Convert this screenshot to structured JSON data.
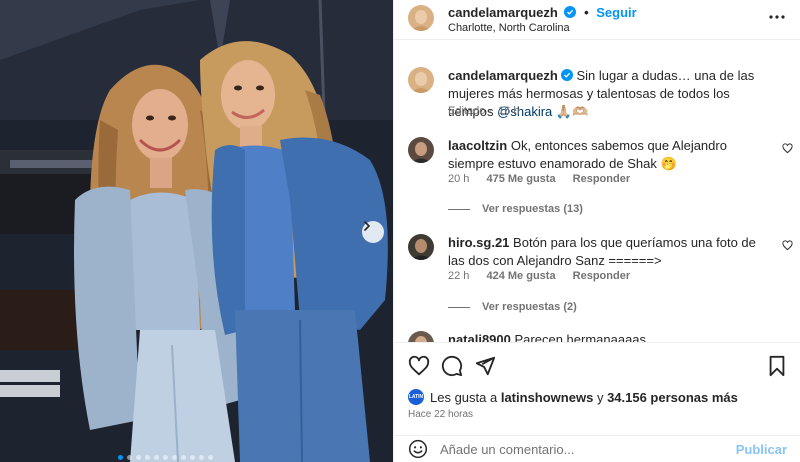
{
  "post": {
    "username": "candelamarquezh",
    "follow_label": "Seguir",
    "separator": "•",
    "location": "Charlotte, North Carolina",
    "caption": {
      "username": "candelamarquezh",
      "text": "Sin lugar a dudas… una de las mujeres más hermosas y talentosas de todos los tiempos",
      "mention": "@shakira",
      "emoji": "🙏🏼🫶🏼",
      "edited": "Editado",
      "time": "16 h"
    },
    "comments": [
      {
        "username": "laacoltzin",
        "text": "Ok, entonces sabemos que Alejandro siempre estuvo enamorado de Shak 🤭",
        "time": "20 h",
        "likes": "475 Me gusta",
        "reply_label": "Responder",
        "view_replies": "Ver respuestas (13)"
      },
      {
        "username": "hiro.sg.21",
        "text": "Botón para los que queríamos una foto de las dos con Alejandro Sanz ======>",
        "time": "22 h",
        "likes": "424 Me gusta",
        "reply_label": "Responder",
        "view_replies": "Ver respuestas (2)"
      },
      {
        "username": "natali8900",
        "text": "Parecen hermanaaaas"
      }
    ],
    "likes_summary": {
      "avatar_text": "LATIN",
      "prefix": "Les gusta a",
      "user": "latinshownews",
      "connector": "y",
      "count": "34.156 personas más"
    },
    "time_ago": "Hace 22 horas",
    "comment_placeholder": "Añade un comentario...",
    "post_label": "Publicar",
    "carousel_dots": 11,
    "carousel_active": 0
  },
  "colors": {
    "accent": "#0095f6",
    "verified": "#0095f6",
    "muted": "#737373",
    "post_disabled": "#88c4f6"
  },
  "icons": [
    "verified-icon",
    "more-options-icon",
    "heart-icon",
    "comment-icon",
    "share-icon",
    "bookmark-icon",
    "emoji-icon",
    "chevron-right-icon"
  ]
}
